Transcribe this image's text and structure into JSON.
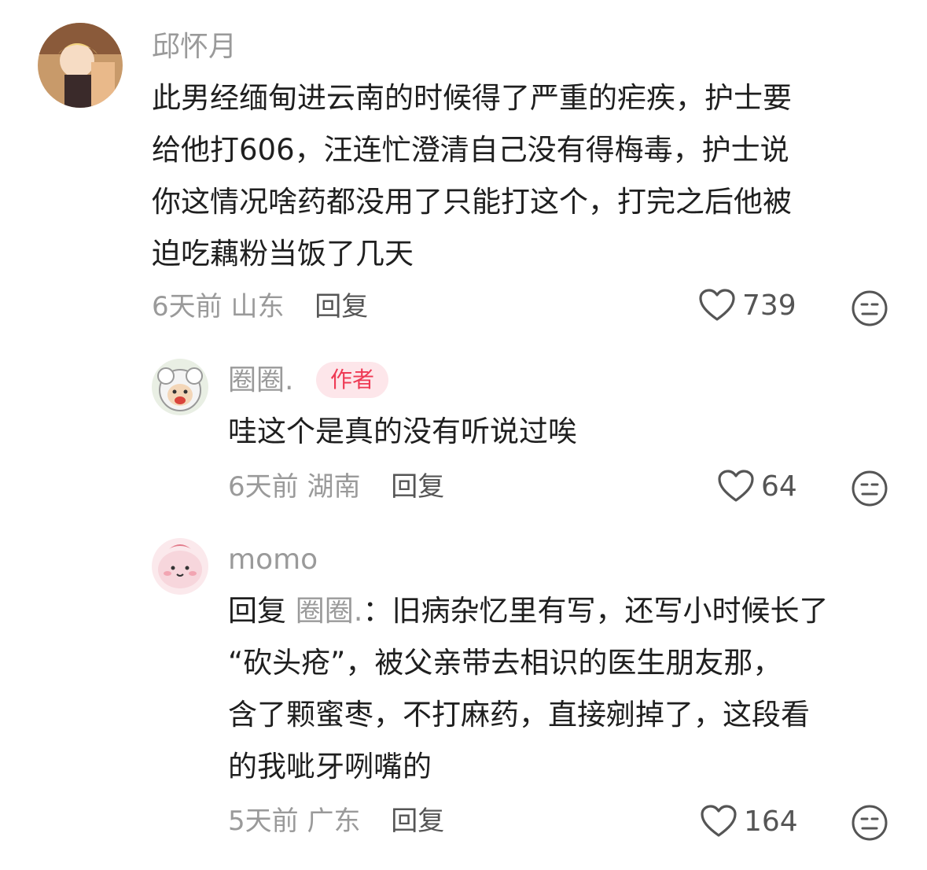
{
  "comments": [
    {
      "username": "邱怀月",
      "lines": [
        "此男经缅甸进云南的时候得了严重的疟疾，护士要",
        "给他打606，汪连忙澄清自己没有得梅毒，护士说",
        "你这情况啥药都没用了只能打这个，打完之后他被",
        "迫吃藕粉当饭了几天"
      ],
      "time": "6天前",
      "location": "山东",
      "reply_label": "回复",
      "likes": "739"
    },
    {
      "username": "圈圈.",
      "badge": "作者",
      "lines": [
        "哇这个是真的没有听说过唉"
      ],
      "time": "6天前",
      "location": "湖南",
      "reply_label": "回复",
      "likes": "64"
    },
    {
      "username": "momo",
      "reply_prefix": "回复",
      "reply_to": "圈圈.",
      "reply_colon": "：",
      "first_line_rest": "旧病杂忆里有写，还写小时候长了",
      "lines": [
        "“砍头疮”，被父亲带去相识的医生朋友那，",
        "含了颗蜜枣，不打麻药，直接剜掉了，这段看",
        "的我呲牙咧嘴的"
      ],
      "time": "5天前",
      "location": "广东",
      "reply_label": "回复",
      "likes": "164"
    }
  ],
  "icons": {
    "heart": "heart-outline-icon",
    "dislike": "meh-face-icon"
  },
  "colors": {
    "badge_bg": "#fde6ea",
    "badge_text": "#ee3a54",
    "muted": "#9a9a9a"
  }
}
